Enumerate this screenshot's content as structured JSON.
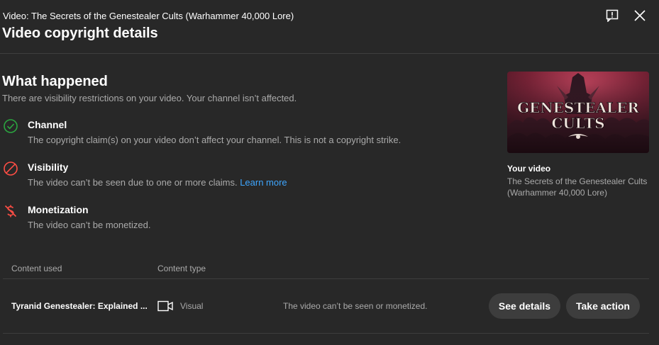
{
  "header": {
    "video_title": "Video: The Secrets of the Genestealer Cults (Warhammer 40,000 Lore)",
    "dialog_title": "Video copyright details"
  },
  "what_happened": {
    "title": "What happened",
    "subtitle": "There are visibility restrictions on your video. Your channel isn’t affected.",
    "items": [
      {
        "label": "Channel",
        "description": "The copyright claim(s) on your video don’t affect your channel. This is not a copyright strike.",
        "icon": "check-circle-icon",
        "color": "#2ba640"
      },
      {
        "label": "Visibility",
        "description": "The video can’t be seen due to one or more claims.",
        "link": "Learn more",
        "icon": "blocked-icon",
        "color": "#ff4e45"
      },
      {
        "label": "Monetization",
        "description": "The video can’t be monetized.",
        "icon": "no-money-icon",
        "color": "#ff4e45"
      }
    ]
  },
  "your_video": {
    "label": "Your video",
    "name": "The Secrets of the Genestealer Cults (Warhammer 40,000 Lore)",
    "thumbnail_text_line1": "GENESTEALER",
    "thumbnail_text_line2": "CULTS"
  },
  "table": {
    "headers": {
      "content_used": "Content used",
      "content_type": "Content type"
    },
    "rows": [
      {
        "content_used": "Tyranid Genestealer: Explained ...",
        "content_type": "Visual",
        "status": "The video can’t be seen or monetized.",
        "see_details": "See details",
        "take_action": "Take action"
      }
    ]
  },
  "colors": {
    "background": "#282828",
    "link": "#3ea6ff",
    "success": "#2ba640",
    "error": "#ff4e45",
    "button": "#3d3d3d"
  }
}
